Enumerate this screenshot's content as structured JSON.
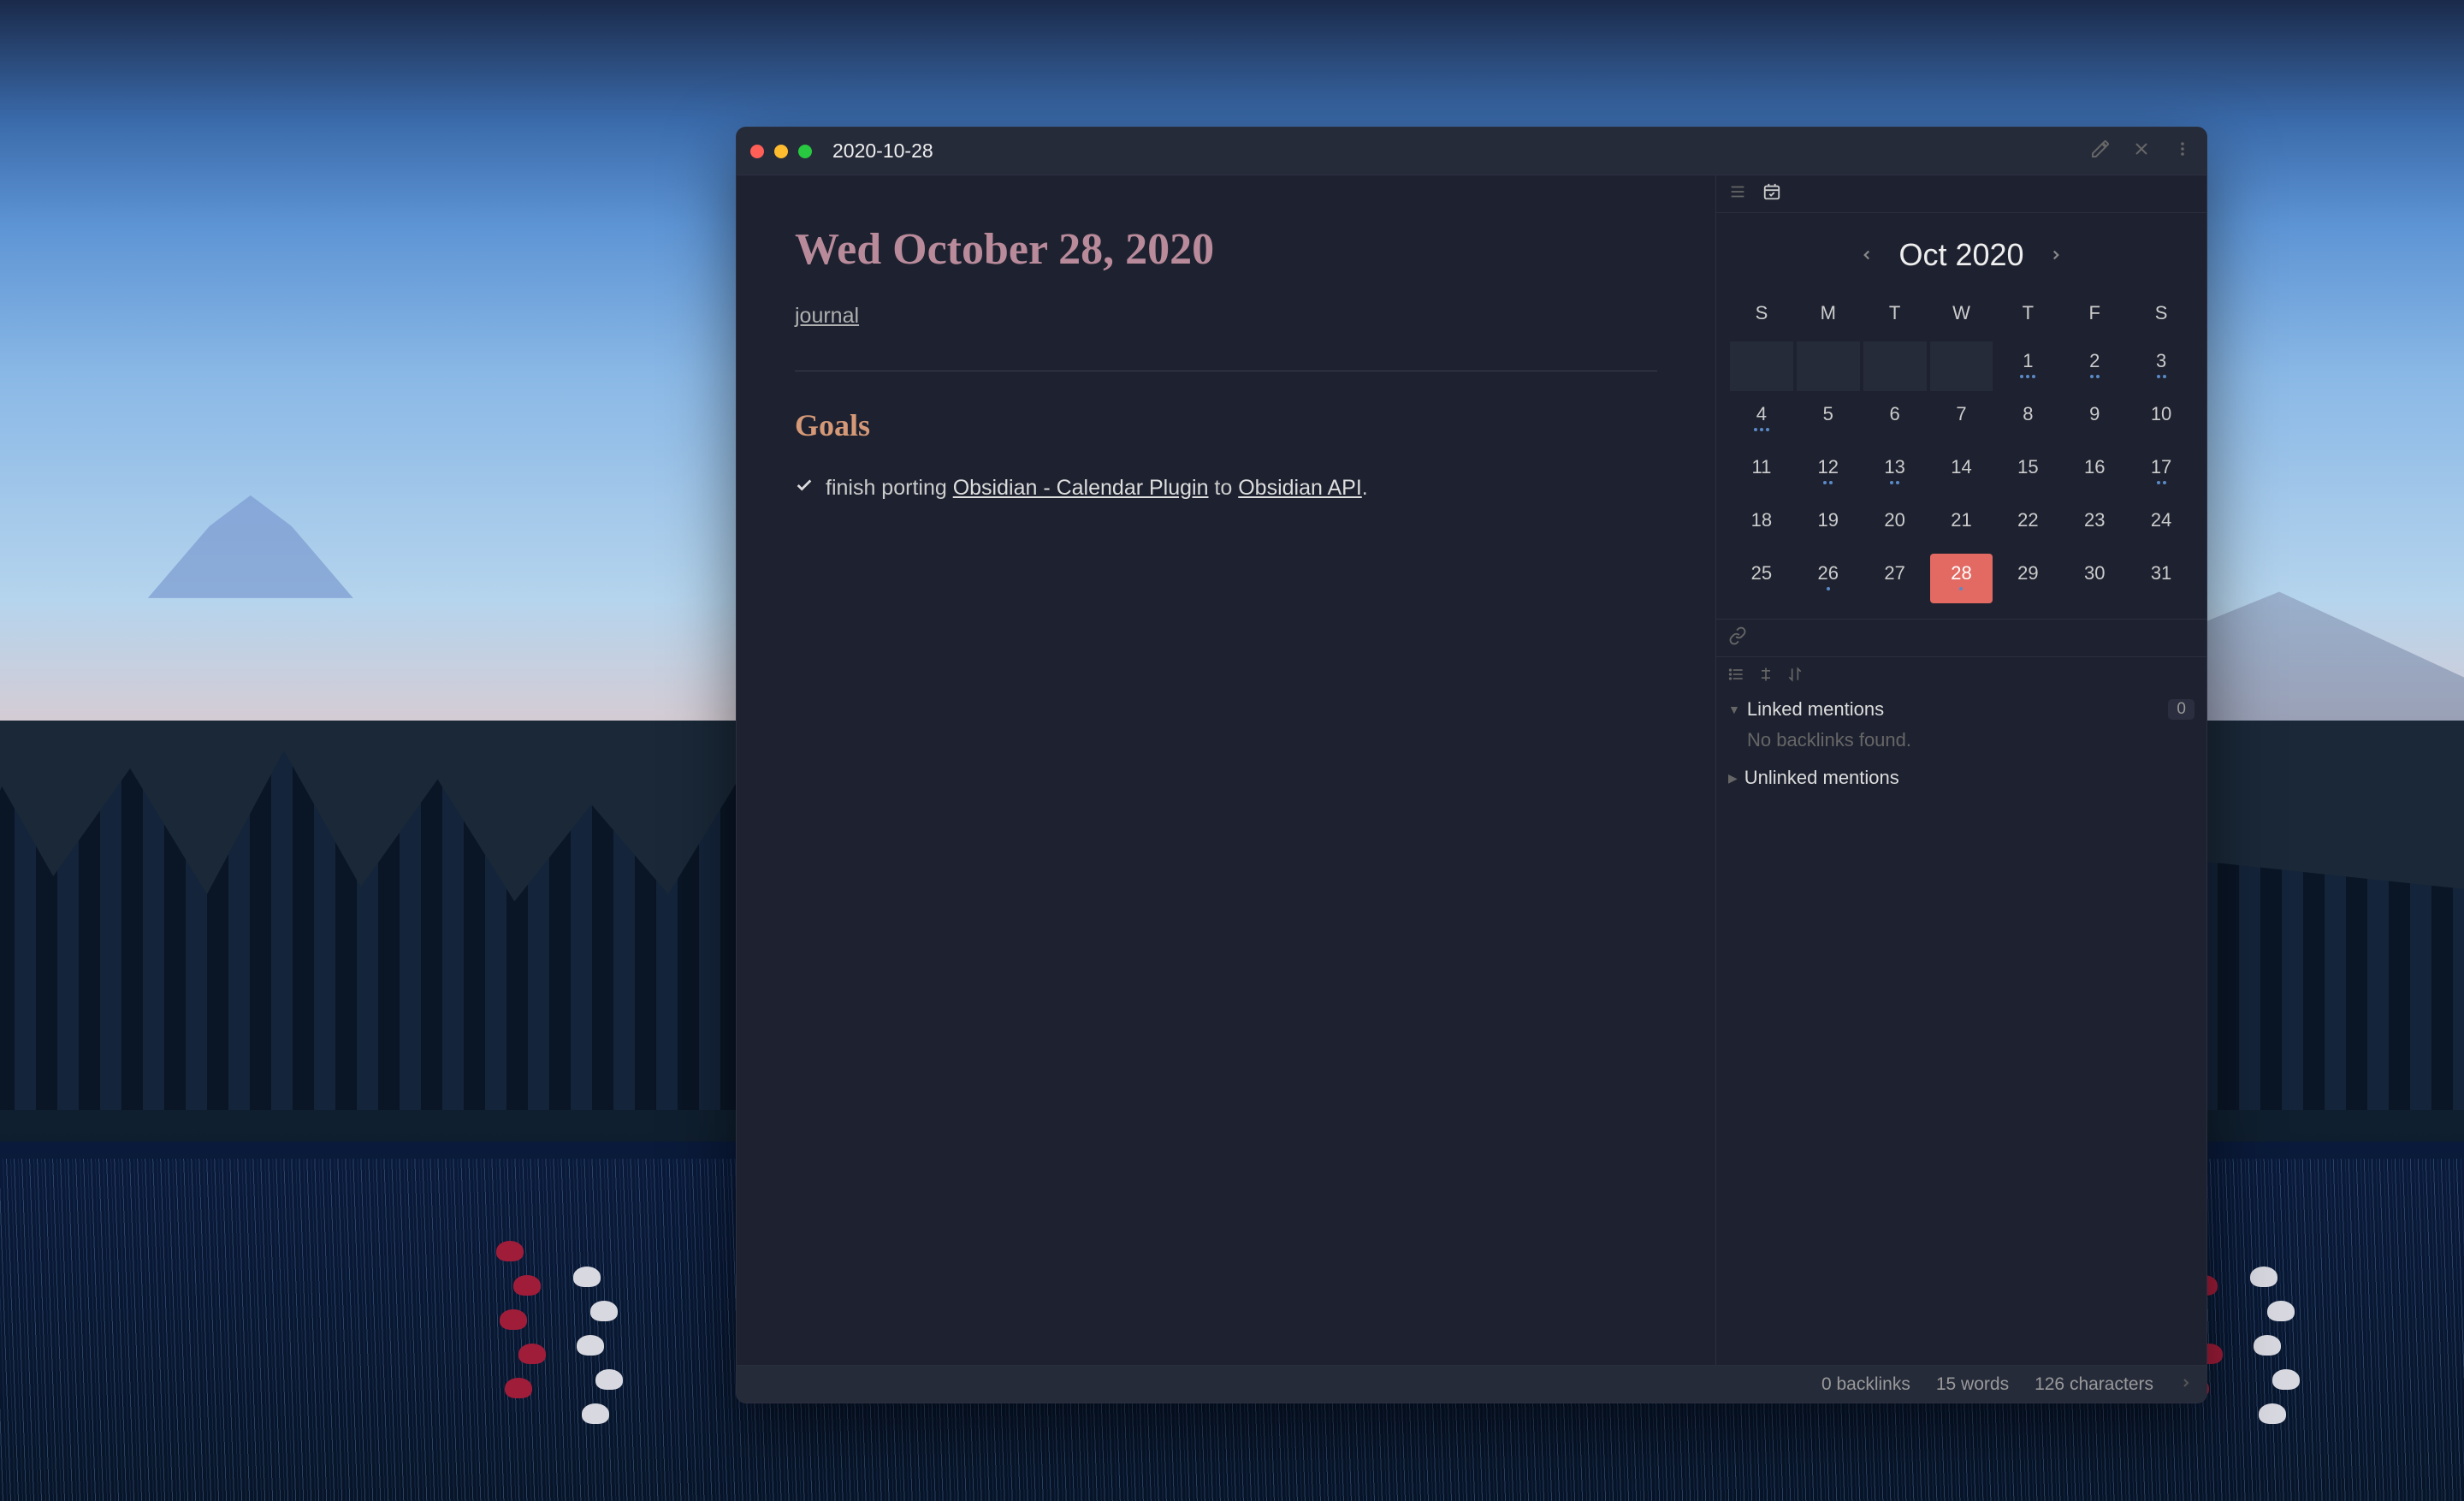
{
  "window": {
    "title": "2020-10-28"
  },
  "note": {
    "heading": "Wed October 28, 2020",
    "tag": "journal",
    "section_goals": "Goals",
    "task_prefix": "finish porting ",
    "task_link1": "Obsidian - Calendar Plugin",
    "task_mid": " to ",
    "task_link2": "Obsidian API",
    "task_suffix": "."
  },
  "calendar": {
    "title": "Oct 2020",
    "dow": [
      "S",
      "M",
      "T",
      "W",
      "T",
      "F",
      "S"
    ],
    "blanks": 4,
    "today": 28,
    "days": [
      {
        "n": 1,
        "dots": 3
      },
      {
        "n": 2,
        "dots": 2
      },
      {
        "n": 3,
        "dots": 2
      },
      {
        "n": 4,
        "dots": 3
      },
      {
        "n": 5,
        "dots": 0
      },
      {
        "n": 6,
        "dots": 0
      },
      {
        "n": 7,
        "dots": 0
      },
      {
        "n": 8,
        "dots": 0
      },
      {
        "n": 9,
        "dots": 0
      },
      {
        "n": 10,
        "dots": 0
      },
      {
        "n": 11,
        "dots": 0
      },
      {
        "n": 12,
        "dots": 2
      },
      {
        "n": 13,
        "dots": 2
      },
      {
        "n": 14,
        "dots": 0
      },
      {
        "n": 15,
        "dots": 0
      },
      {
        "n": 16,
        "dots": 0
      },
      {
        "n": 17,
        "dots": 2
      },
      {
        "n": 18,
        "dots": 0
      },
      {
        "n": 19,
        "dots": 0
      },
      {
        "n": 20,
        "dots": 0
      },
      {
        "n": 21,
        "dots": 0
      },
      {
        "n": 22,
        "dots": 0
      },
      {
        "n": 23,
        "dots": 0
      },
      {
        "n": 24,
        "dots": 0
      },
      {
        "n": 25,
        "dots": 0
      },
      {
        "n": 26,
        "dots": 1
      },
      {
        "n": 27,
        "dots": 0
      },
      {
        "n": 28,
        "dots": 1
      },
      {
        "n": 29,
        "dots": 0
      },
      {
        "n": 30,
        "dots": 0
      },
      {
        "n": 31,
        "dots": 0
      }
    ]
  },
  "backlinks": {
    "linked_label": "Linked mentions",
    "linked_count": "0",
    "linked_empty": "No backlinks found.",
    "unlinked_label": "Unlinked mentions"
  },
  "status": {
    "backlinks": "0 backlinks",
    "words": "15 words",
    "chars": "126 characters"
  }
}
